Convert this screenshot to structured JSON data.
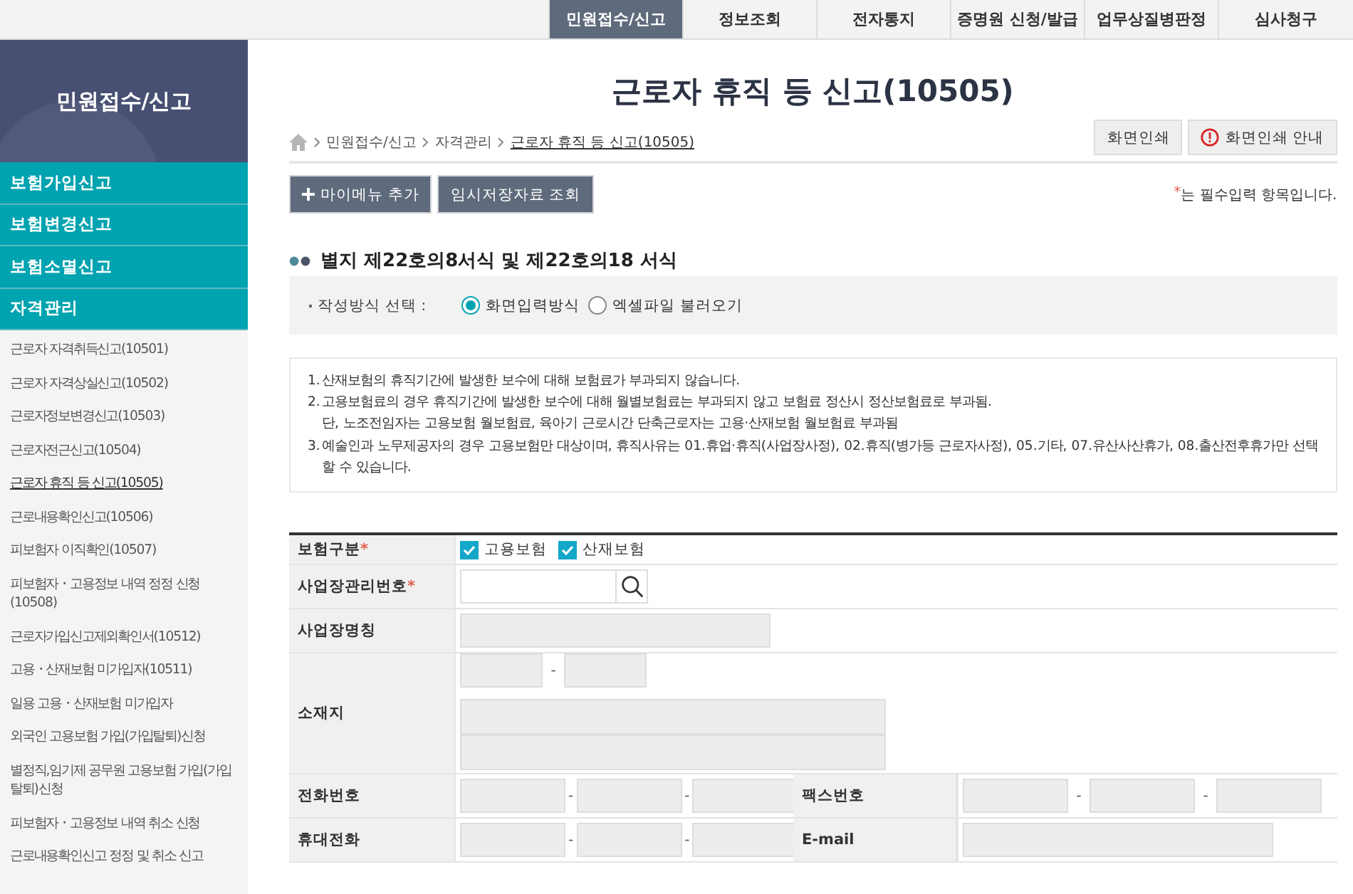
{
  "top_nav": [
    {
      "label": "민원접수/신고",
      "selected": true
    },
    {
      "label": "정보조회",
      "selected": false
    },
    {
      "label": "전자통지",
      "selected": false
    },
    {
      "label": "증명원 신청/발급",
      "selected": false
    },
    {
      "label": "업무상질병판정",
      "selected": false
    },
    {
      "label": "심사청구",
      "selected": false
    }
  ],
  "sidebar": {
    "title": "민원접수/신고",
    "sections": [
      {
        "label": "보험가입신고"
      },
      {
        "label": "보험변경신고"
      },
      {
        "label": "보험소멸신고"
      },
      {
        "label": "자격관리"
      }
    ],
    "items": [
      {
        "label": "근로자 자격취득신고(10501)",
        "selected": false
      },
      {
        "label": "근로자 자격상실신고(10502)",
        "selected": false
      },
      {
        "label": "근로자정보변경신고(10503)",
        "selected": false
      },
      {
        "label": "근로자전근신고(10504)",
        "selected": false
      },
      {
        "label": "근로자 휴직 등 신고(10505)",
        "selected": true
      },
      {
        "label": "근로내용확인신고(10506)",
        "selected": false
      },
      {
        "label": "피보험자 이직확인(10507)",
        "selected": false
      },
      {
        "label": "피보험자・고용정보 내역 정정 신청 (10508)",
        "selected": false
      },
      {
        "label": "근로자가입신고제외확인서(10512)",
        "selected": false
      },
      {
        "label": "고용・산재보험 미가입자(10511)",
        "selected": false
      },
      {
        "label": "일용 고용・산재보험 미가입자",
        "selected": false
      },
      {
        "label": "외국인 고용보험 가입(가입탈퇴)신청",
        "selected": false
      },
      {
        "label": "별정직,임기제 공무원 고용보험 가입(가입탈퇴)신청",
        "selected": false
      },
      {
        "label": "피보험자・고용정보 내역 취소 신청",
        "selected": false
      },
      {
        "label": "근로내용확인신고 정정 및 취소 신고",
        "selected": false
      }
    ]
  },
  "page": {
    "title": "근로자 휴직 등 신고(10505)",
    "breadcrumb": [
      {
        "label": "민원접수/신고",
        "current": false
      },
      {
        "label": "자격관리",
        "current": false
      },
      {
        "label": "근로자 휴직 등 신고(10505)",
        "current": true
      }
    ],
    "actions": [
      {
        "label": "화면인쇄",
        "kind": "plain"
      },
      {
        "label": "화면인쇄 안내",
        "kind": "info"
      }
    ],
    "toolbar": [
      {
        "label": "마이메뉴 추가",
        "kind": "add"
      },
      {
        "label": "임시저장자료 조회",
        "kind": "plain"
      }
    ],
    "required_note": {
      "mark": "*",
      "text": "는 필수입력 항목입니다."
    }
  },
  "section_title": "별지 제22호의8서식 및 제22호의18 서식",
  "mode": {
    "label": "작성방식 선택 :",
    "options": [
      {
        "label": "화면입력방식",
        "selected": true
      },
      {
        "label": "엑셀파일 불러오기",
        "selected": false
      }
    ]
  },
  "notes": [
    {
      "number": "1.",
      "lines": [
        "산재보험의 휴직기간에 발생한 보수에 대해 보험료가 부과되지 않습니다."
      ]
    },
    {
      "number": "2.",
      "lines": [
        "고용보험료의 경우 휴직기간에 발생한 보수에 대해 월별보험료는 부과되지 않고 보험료 정산시 정산보험료로 부과됨.",
        "단, 노조전임자는 고용보험 월보험료, 육아기 근로시간 단축근로자는 고용·산재보험 월보험료 부과됨"
      ]
    },
    {
      "number": "3.",
      "lines": [
        "예술인과 노무제공자의 경우 고용보험만 대상이며, 휴직사유는 01.휴업·휴직(사업장사정), 02.휴직(병가등 근로자사정), 05.기타, 07.유산사산휴가, 08.출산전후휴가만 선택",
        "할 수 있습니다."
      ]
    }
  ],
  "form": {
    "rows": [
      {
        "kind": "checkboxes",
        "label": "보험구분",
        "required_mark": "*",
        "options": [
          {
            "label": "고용보험",
            "checked": true
          },
          {
            "label": "산재보험",
            "checked": true
          }
        ]
      },
      {
        "kind": "search",
        "label": "사업장관리번호",
        "required_mark": "*"
      },
      {
        "kind": "text",
        "label": "사업장명칭",
        "inputs": [
          {
            "disabled": true
          }
        ]
      },
      {
        "kind": "address",
        "label": "소재지",
        "zip": {
          "separator": "-",
          "inputs": [
            {
              "disabled": true
            },
            {
              "disabled": true
            }
          ]
        },
        "lines": [
          {
            "disabled": true
          },
          {
            "disabled": true
          }
        ]
      },
      {
        "kind": "pair",
        "cells": [
          {
            "label": "전화번호",
            "separator": "-",
            "inputs": [
              {
                "disabled": true
              },
              {
                "disabled": true
              },
              {
                "disabled": true
              }
            ]
          },
          {
            "label": "팩스번호",
            "separator": "-",
            "inputs": [
              {
                "disabled": true
              },
              {
                "disabled": true
              },
              {
                "disabled": true
              }
            ]
          }
        ]
      },
      {
        "kind": "pair",
        "cells": [
          {
            "label": "휴대전화",
            "separator": "-",
            "inputs": [
              {
                "disabled": true
              },
              {
                "disabled": true
              },
              {
                "disabled": true
              }
            ]
          },
          {
            "label": "E-mail",
            "inputs": [
              {
                "disabled": true
              }
            ]
          }
        ]
      }
    ]
  }
}
